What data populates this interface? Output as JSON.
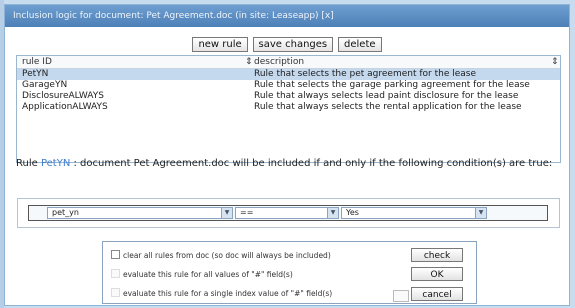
{
  "window": {
    "title": "Inclusion logic for document: Pet Agreement.doc (in site: Leaseapp) [x]"
  },
  "toolbar": {
    "new_rule": "new rule",
    "save_changes": "save changes",
    "delete": "delete"
  },
  "grid": {
    "headers": [
      "rule ID",
      "description"
    ],
    "rows": [
      {
        "id": "PetYN",
        "description": "Rule that selects the pet agreement for the lease",
        "selected": true
      },
      {
        "id": "GarageYN",
        "description": "Rule that selects the garage parking agreement for the lease",
        "selected": false
      },
      {
        "id": "DisclosureALWAYS",
        "description": "Rule that always selects lead paint disclosure for the lease",
        "selected": false
      },
      {
        "id": "ApplicationALWAYS",
        "description": "Rule that always selects the rental application for the lease",
        "selected": false
      }
    ]
  },
  "rule_text": {
    "prefix": "Rule",
    "name": "PetYN",
    "suffix": ":  document Pet Agreement.doc will be included if and only if the following condition(s) are true:"
  },
  "condition": {
    "field": "pet_yn",
    "operator": "==",
    "value": "Yes"
  },
  "options": {
    "clear_all": "clear all rules from doc (so doc will always be included)",
    "eval_all": "evaluate this rule for all values of \"#\" field(s)",
    "eval_single": "evaluate this rule for a single index value of \"#\" field(s)",
    "check_label": "check",
    "ok_label": "OK",
    "cancel_label": "cancel"
  }
}
